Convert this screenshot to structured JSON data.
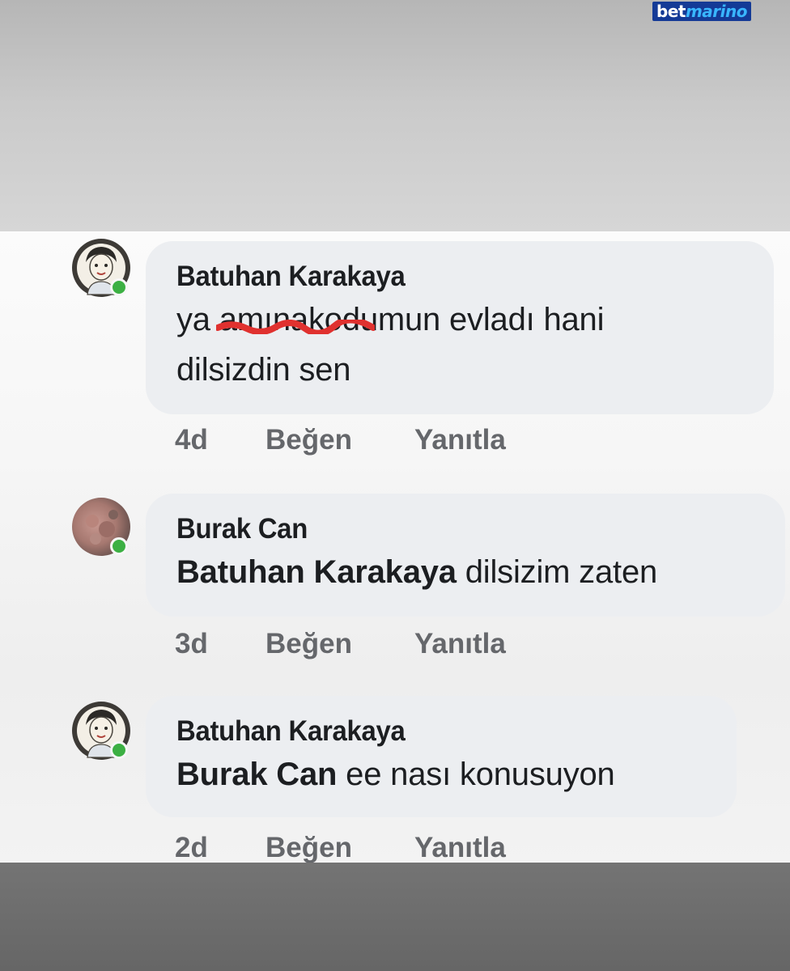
{
  "watermark": {
    "part1": "bet",
    "part2": "marino"
  },
  "comments": [
    {
      "author": "Batuhan Karakaya",
      "text_prefix": "ya ",
      "censored_text": "amınakodumun",
      "censored_visible_tail": "dumun evladı hani",
      "text_line2": "dilsizdin sen",
      "time": "4d",
      "like_label": "Beğen",
      "reply_label": "Yanıtla",
      "avatar_icon": "cartoon-person-avatar",
      "online": true
    },
    {
      "author": "Burak Can",
      "mention": "Batuhan Karakaya",
      "text": " dilsizim zaten",
      "time": "3d",
      "like_label": "Beğen",
      "reply_label": "Yanıtla",
      "avatar_icon": "photo-avatar",
      "online": true
    },
    {
      "author": "Batuhan Karakaya",
      "mention": "Burak Can",
      "text": " ee nası konusuyon",
      "time": "2d",
      "like_label": "Beğen",
      "reply_label": "Yanıtla",
      "avatar_icon": "cartoon-person-avatar",
      "online": true
    }
  ],
  "colors": {
    "bubble": "#eceef1",
    "author_text": "#1c1e21",
    "meta_text": "#65676b",
    "online": "#3cb043",
    "censor_scribble": "#e0312f"
  }
}
